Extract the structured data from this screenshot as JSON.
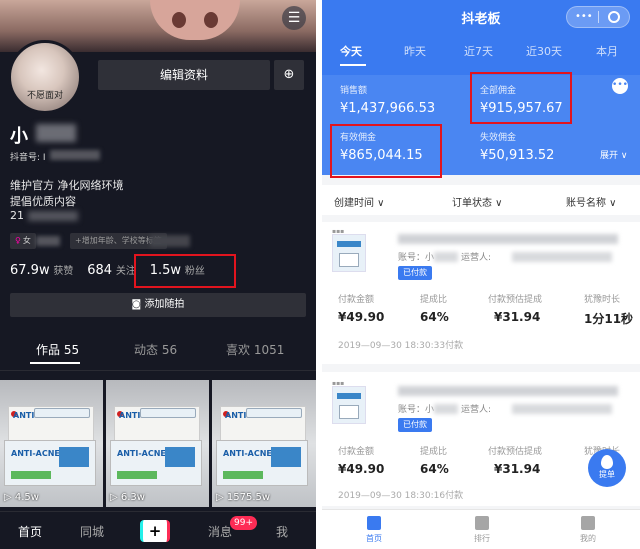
{
  "left": {
    "avatar_caption": "不愿面对",
    "edit_profile_label": "编辑资料",
    "add_friend_icon": "add-friend-icon",
    "nickname": "小",
    "douyin_id_label": "抖音号: I",
    "bio_lines": [
      "维护官方 净化网络环境",
      "提倡优质内容",
      "21"
    ],
    "gender_tag": "女",
    "gender_symbol": "♀",
    "add_tag": "+增加年龄、学校等标签",
    "stats": {
      "likes_num": "67.9w",
      "likes_label": "获赞",
      "following_num": "684",
      "following_label": "关注",
      "followers_num": "1.5w",
      "followers_label": "粉丝"
    },
    "add_post_label": "添加随拍",
    "tabs": [
      {
        "label": "作品 55"
      },
      {
        "label": "动态 56"
      },
      {
        "label": "喜欢 1051"
      }
    ],
    "thumbs": [
      {
        "brand": "ANTI-ACNE",
        "views": "4.5w"
      },
      {
        "brand": "ANTI-ACNE",
        "views": "6.3w"
      },
      {
        "brand": "ANTI-ACNE",
        "views": "1575.5w"
      }
    ],
    "bottom_nav": {
      "home": "首页",
      "city": "同城",
      "plus": "+",
      "messages": "消息",
      "messages_badge": "99+",
      "me": "我"
    },
    "accent": "#e2141e"
  },
  "right": {
    "title": "抖老板",
    "capsule_dots": "•••",
    "time_tabs": [
      {
        "label": "今天"
      },
      {
        "label": "昨天"
      },
      {
        "label": "近7天"
      },
      {
        "label": "近30天"
      },
      {
        "label": "本月"
      }
    ],
    "stats": {
      "sales_label": "销售额",
      "sales_value": "¥1,437,966.53",
      "total_comm_label": "全部佣金",
      "total_comm_value": "¥915,957.67",
      "valid_comm_label": "有效佣金",
      "valid_comm_value": "¥865,044.15",
      "invalid_comm_label": "失效佣金",
      "invalid_comm_value": "¥50,913.52",
      "more": "•••",
      "expand_label": "展开 ∨"
    },
    "filters": {
      "created_time": "创建时间 ∨",
      "order_status": "订单状态 ∨",
      "account_name": "账号名称 ∨"
    },
    "orders": [
      {
        "account_text": "账号：小",
        "operator_text": "运营人:",
        "status_badge": "已付款",
        "cols": [
          {
            "label": "付款金额",
            "value": "¥49.90"
          },
          {
            "label": "提成比",
            "value": "64%"
          },
          {
            "label": "付款预估提成",
            "value": "¥31.94"
          },
          {
            "label": "犹豫时长",
            "value": "1分11秒"
          }
        ],
        "time": "2019—09—30 18:30:33付款"
      },
      {
        "account_text": "账号：小",
        "operator_text": "运营人:",
        "status_badge": "已付款",
        "cols": [
          {
            "label": "付款金额",
            "value": "¥49.90"
          },
          {
            "label": "提成比",
            "value": "64%"
          },
          {
            "label": "付款预估提成",
            "value": "¥31.94"
          },
          {
            "label": "犹豫时长",
            "value": ""
          }
        ],
        "time": "2019—09—30 18:30:16付款"
      }
    ],
    "float_button_label": "提单",
    "bottom_nav": [
      {
        "label": "首页"
      },
      {
        "label": "排行"
      },
      {
        "label": "我的"
      }
    ],
    "brand_color": "#3a7af0"
  }
}
